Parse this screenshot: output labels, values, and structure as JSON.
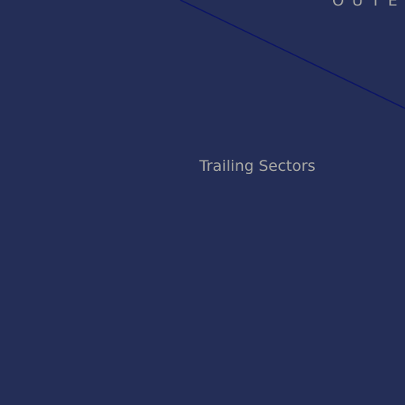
{
  "map": {
    "background_color": "#242e57",
    "route_color": "#0b1466",
    "label_color": "#a8a8a4",
    "labels": {
      "sector": "Trailing Sectors",
      "region": "OUTER"
    }
  }
}
